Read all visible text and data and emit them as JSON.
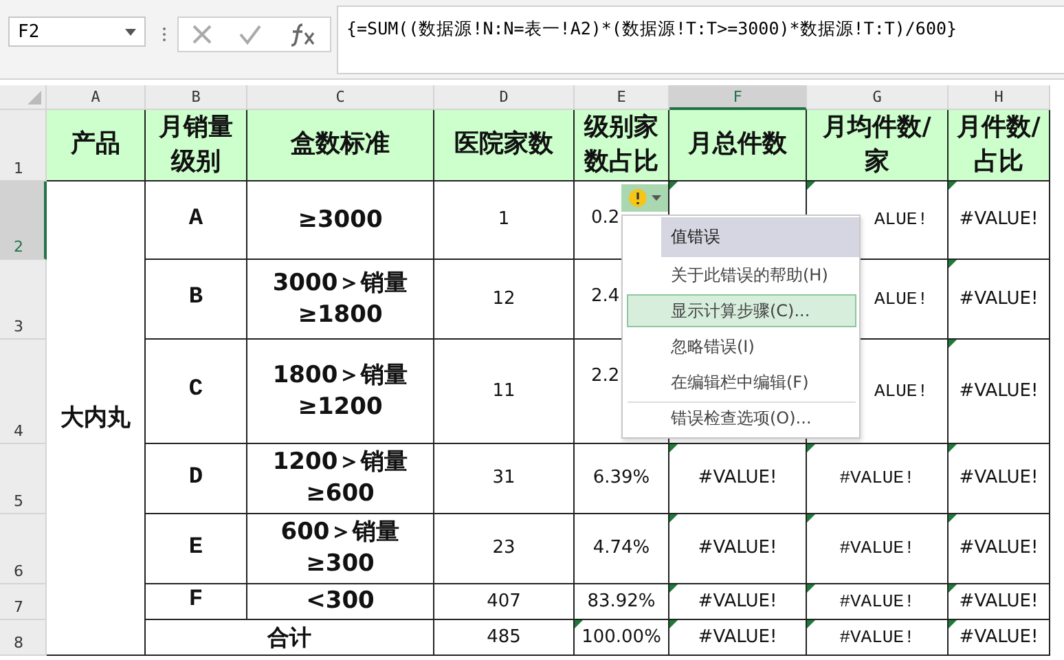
{
  "name_box": "F2",
  "formula": "{=SUM((数据源!N:N=表一!A2)*(数据源!T:T>=3000)*数据源!T:T)/600}",
  "columns": [
    {
      "label": "A",
      "selected": false
    },
    {
      "label": "B",
      "selected": false
    },
    {
      "label": "C",
      "selected": false
    },
    {
      "label": "D",
      "selected": false
    },
    {
      "label": "E",
      "selected": false
    },
    {
      "label": "F",
      "selected": true
    },
    {
      "label": "G",
      "selected": false
    },
    {
      "label": "H",
      "selected": false
    }
  ],
  "row_headers": [
    {
      "label": "1",
      "selected": false
    },
    {
      "label": "2",
      "selected": true
    },
    {
      "label": "3",
      "selected": false
    },
    {
      "label": "4",
      "selected": false
    },
    {
      "label": "5",
      "selected": false
    },
    {
      "label": "6",
      "selected": false
    },
    {
      "label": "7",
      "selected": false
    },
    {
      "label": "8",
      "selected": false
    }
  ],
  "header": [
    "产品",
    "月销量级别",
    "盒数标准",
    "医院家数",
    "级别家数占比",
    "月总件数",
    "月均件数/家",
    "月件数/占比"
  ],
  "product": "大内丸",
  "rows": [
    {
      "level": "A",
      "standard": "≥3000",
      "hospitals": "1",
      "share": "0.2",
      "total": "",
      "avg": "ALUE!",
      "ratio": "#VALUE!"
    },
    {
      "level": "B",
      "standard": "3000＞销量≥1800",
      "hospitals": "12",
      "share": "2.4",
      "total": "",
      "avg": "ALUE!",
      "ratio": "#VALUE!"
    },
    {
      "level": "C",
      "standard": "1800＞销量≥1200",
      "hospitals": "11",
      "share": "2.2",
      "total": "",
      "avg": "ALUE!",
      "ratio": "#VALUE!"
    },
    {
      "level": "D",
      "standard": "1200＞销量≥600",
      "hospitals": "31",
      "share": "6.39%",
      "total": "#VALUE!",
      "avg": "#VALUE!",
      "ratio": "#VALUE!"
    },
    {
      "level": "E",
      "standard": "600＞销量≥300",
      "hospitals": "23",
      "share": "4.74%",
      "total": "#VALUE!",
      "avg": "#VALUE!",
      "ratio": "#VALUE!"
    },
    {
      "level": "F",
      "standard": "<300",
      "hospitals": "407",
      "share": "83.92%",
      "total": "#VALUE!",
      "avg": "#VALUE!",
      "ratio": "#VALUE!"
    }
  ],
  "total_row": {
    "label": "合计",
    "hospitals": "485",
    "share": "100.00%",
    "total": "#VALUE!",
    "avg": "#VALUE!",
    "ratio": "#VALUE!"
  },
  "error_menu": {
    "items": [
      {
        "label": "值错误",
        "kind": "title",
        "selected": false
      },
      {
        "label": "关于此错误的帮助(H)",
        "kind": "item",
        "selected": false
      },
      {
        "label": "显示计算步骤(C)...",
        "kind": "item",
        "selected": true
      },
      {
        "label": "忽略错误(I)",
        "kind": "item",
        "selected": false
      },
      {
        "label": "在编辑栏中编辑(F)",
        "kind": "item",
        "selected": false
      },
      {
        "label": "错误检查选项(O)...",
        "kind": "separated",
        "selected": false
      }
    ]
  }
}
